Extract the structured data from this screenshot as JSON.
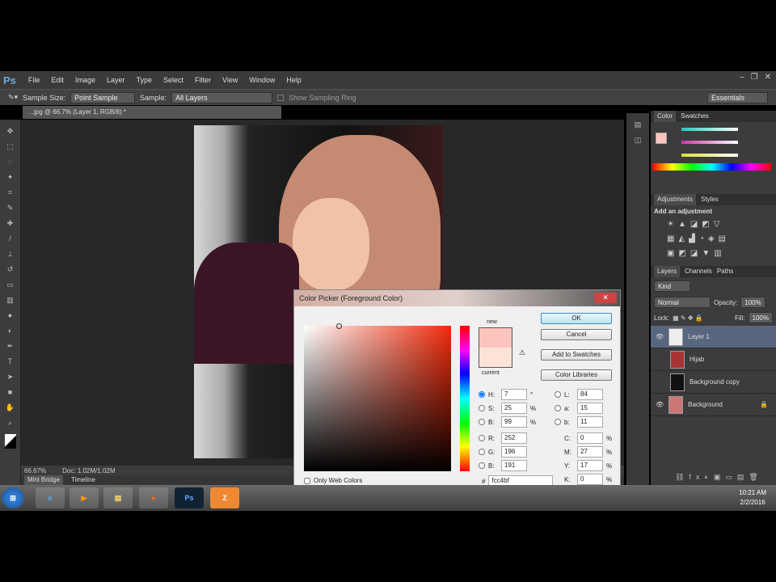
{
  "menubar": {
    "logo": "Ps",
    "items": [
      "File",
      "Edit",
      "Image",
      "Layer",
      "Type",
      "Select",
      "Filter",
      "View",
      "Window",
      "Help"
    ],
    "window_buttons": [
      "–",
      "❐",
      "✕"
    ]
  },
  "options": {
    "sample_size_label": "Sample Size:",
    "sample_size": "Point Sample",
    "sample_label": "Sample:",
    "sample": "All Layers",
    "ring_label": "Show Sampling Ring",
    "workspace": "Essentials"
  },
  "document": {
    "tab_title": "…jpg @ 66.7% (Layer 1, RGB/8) *",
    "zoom": "66.67%",
    "doc_size": "Doc: 1.02M/1.02M"
  },
  "bottom_tabs": [
    "Mini Bridge",
    "Timeline"
  ],
  "panels": {
    "color_tabs": [
      "Color",
      "Swatches"
    ],
    "adj_tabs": [
      "Adjustments",
      "Styles"
    ],
    "adj_heading": "Add an adjustment",
    "layer_tabs": [
      "Layers",
      "Channels",
      "Paths"
    ],
    "kind": "Kind",
    "blend": "Normal",
    "opacity_label": "Opacity:",
    "opacity": "100%",
    "lock_label": "Lock:",
    "fill_label": "Fill:",
    "fill": "100%",
    "layers": [
      {
        "name": "Layer 1",
        "selected": true
      },
      {
        "name": "Hijab"
      },
      {
        "name": "Background copy"
      },
      {
        "name": "Background"
      }
    ]
  },
  "dialog": {
    "title": "Color Picker (Foreground Color)",
    "ok": "OK",
    "cancel": "Cancel",
    "add_swatches": "Add to Swatches",
    "libraries": "Color Libraries",
    "new_label": "new",
    "current_label": "current",
    "web_only": "Only Web Colors",
    "new_color": "#fcc4bf",
    "current_color": "#fde3d6",
    "hsb": [
      {
        "l": "H:",
        "v": "7",
        "u": "°"
      },
      {
        "l": "S:",
        "v": "25",
        "u": "%"
      },
      {
        "l": "B:",
        "v": "99",
        "u": "%"
      }
    ],
    "rgb": [
      {
        "l": "R:",
        "v": "252"
      },
      {
        "l": "G:",
        "v": "196"
      },
      {
        "l": "B:",
        "v": "191"
      }
    ],
    "lab": [
      {
        "l": "L:",
        "v": "84"
      },
      {
        "l": "a:",
        "v": "15"
      },
      {
        "l": "b:",
        "v": "11"
      }
    ],
    "cmyk": [
      {
        "l": "C:",
        "v": "0",
        "u": "%"
      },
      {
        "l": "M:",
        "v": "27",
        "u": "%"
      },
      {
        "l": "Y:",
        "v": "17",
        "u": "%"
      },
      {
        "l": "K:",
        "v": "0",
        "u": "%"
      }
    ],
    "hex_label": "#",
    "hex": "fcc4bf"
  },
  "taskbar": {
    "time": "10:21 AM",
    "date": "2/2/2016"
  }
}
